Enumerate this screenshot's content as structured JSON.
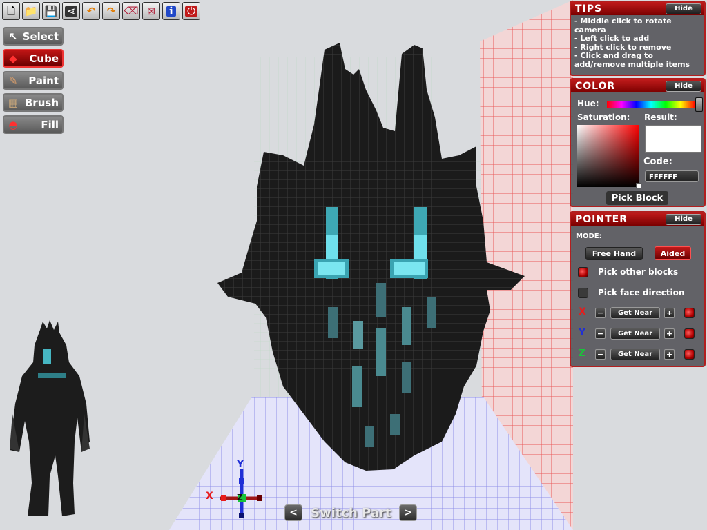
{
  "toolbar": {
    "buttons": [
      {
        "name": "new-file-icon",
        "glyph": "🗋"
      },
      {
        "name": "open-folder-icon",
        "glyph": "📁"
      },
      {
        "name": "save-icon",
        "glyph": "💾"
      },
      {
        "name": "share-icon",
        "glyph": "⋖"
      },
      {
        "name": "undo-icon",
        "glyph": "↶"
      },
      {
        "name": "redo-icon",
        "glyph": "↷"
      },
      {
        "name": "eraser-icon",
        "glyph": "⌫"
      },
      {
        "name": "clear-icon",
        "glyph": "⊠"
      },
      {
        "name": "info-icon",
        "glyph": "ℹ"
      },
      {
        "name": "exit-icon",
        "glyph": "⏻"
      }
    ]
  },
  "tools": [
    {
      "label": "Select",
      "icon": "cursor-icon",
      "glyph": "↖",
      "active": false
    },
    {
      "label": "Cube",
      "icon": "cube-icon",
      "glyph": "◆",
      "active": true
    },
    {
      "label": "Paint",
      "icon": "paint-icon",
      "glyph": "✎",
      "active": false
    },
    {
      "label": "Brush",
      "icon": "brush-icon",
      "glyph": "▦",
      "active": false
    },
    {
      "label": "Fill",
      "icon": "fill-bucket-icon",
      "glyph": "◓",
      "active": false
    }
  ],
  "tips": {
    "title": "TIPS",
    "hide": "Hide",
    "lines": [
      "- Middle click to rotate",
      "camera",
      "- Left click to add",
      "- Right click to remove",
      "- Click and drag to",
      "add/remove multiple items"
    ]
  },
  "color": {
    "title": "COLOR",
    "hide": "Hide",
    "hue_label": "Hue:",
    "saturation_label": "Saturation:",
    "result_label": "Result:",
    "code_label": "Code:",
    "code_value": "FFFFFF",
    "pick_block": "Pick Block",
    "result_color": "#FFFFFF",
    "saturation_hue_color": "#FF0000"
  },
  "pointer": {
    "title": "POINTER",
    "hide": "Hide",
    "mode_label": "MODE:",
    "free_hand": "Free Hand",
    "aided": "Aided",
    "pick_other_blocks": "Pick other blocks",
    "pick_face_direction": "Pick face direction",
    "axes": [
      {
        "letter": "X",
        "color": "#e81b1b",
        "minus": "−",
        "get_near": "Get Near",
        "plus": "+"
      },
      {
        "letter": "Y",
        "color": "#1f2fd6",
        "minus": "−",
        "get_near": "Get Near",
        "plus": "+"
      },
      {
        "letter": "Z",
        "color": "#19c43a",
        "minus": "−",
        "get_near": "Get Near",
        "plus": "+"
      }
    ]
  },
  "gizmo": {
    "x": "X",
    "y": "Y",
    "z": "Z"
  },
  "switch_part": {
    "label": "Switch Part",
    "prev": "<",
    "next": ">"
  },
  "colors": {
    "accent": "#c01b1b",
    "voxel": "#1c1c1c",
    "glow": "#5ad4e0",
    "floor_grid": "#8f8fe8",
    "wall_grid": "#e85a5a"
  }
}
